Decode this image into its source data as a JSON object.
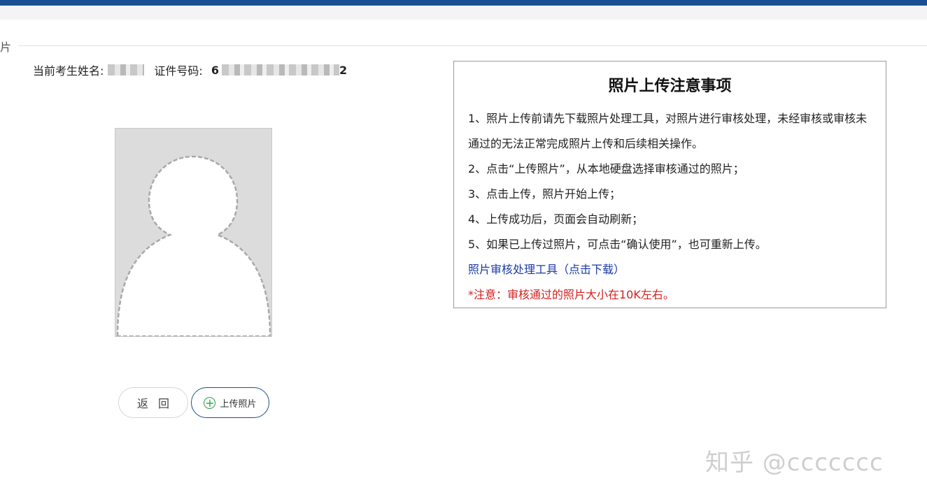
{
  "header": {
    "section_char": "片"
  },
  "info": {
    "name_label": "当前考生姓名:",
    "id_label": "证件号码:",
    "id_prefix": "6",
    "id_suffix": "2"
  },
  "buttons": {
    "back": "返回",
    "upload": "上传照片"
  },
  "notice": {
    "title": "照片上传注意事项",
    "items": [
      "1、照片上传前请先下载照片处理工具，对照片进行审核处理，未经审核或审核未通过的无法正常完成照片上传和后续相关操作。",
      "2、点击“上传照片”，从本地硬盘选择审核通过的照片；",
      "3、点击上传，照片开始上传；",
      "4、上传成功后，页面会自动刷新；",
      "5、如果已上传过照片，可点击“确认使用”，也可重新上传。"
    ],
    "tool_link": "照片审核处理工具（点击下载）",
    "warning": "*注意：审核通过的照片大小在10K左右。"
  },
  "watermark": "知乎 @ccccccc",
  "colors": {
    "topbar": "#1b4f93",
    "link": "#1a3aa8",
    "warning": "#d42020"
  }
}
